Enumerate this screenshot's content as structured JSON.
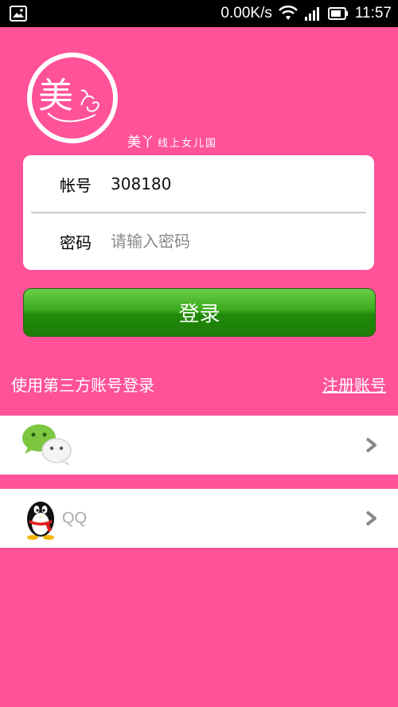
{
  "status_bar": {
    "network_speed": "0.00K/s",
    "time": "11:57"
  },
  "logo": {
    "char": "美",
    "tagline_main": "美丫",
    "tagline_sub": "线上女儿国"
  },
  "login_form": {
    "account_label": "帐号",
    "account_value": "308180",
    "password_label": "密码",
    "password_placeholder": "请输入密码"
  },
  "login_button_label": "登录",
  "third_party": {
    "prompt": "使用第三方账号登录",
    "register_link": "注册账号"
  },
  "social_logins": [
    {
      "name": "wechat",
      "label": "",
      "icon": "wechat-icon"
    },
    {
      "name": "qq",
      "label": "QQ",
      "icon": "qq-penguin-icon"
    }
  ],
  "colors": {
    "background": "#FF5299",
    "login_button": "#2E9B16"
  }
}
